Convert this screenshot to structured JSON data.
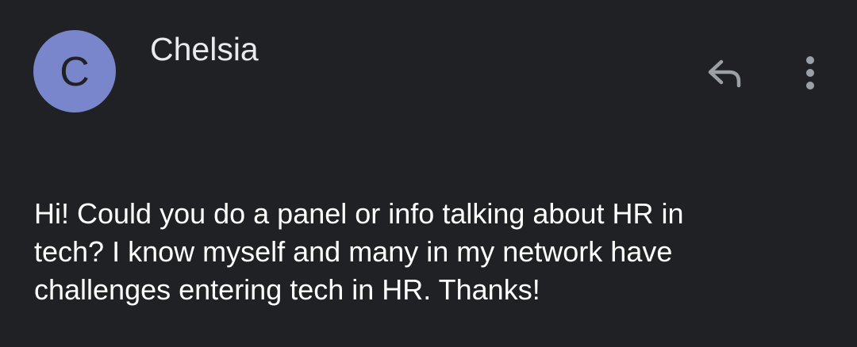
{
  "sender": {
    "avatar_letter": "C",
    "avatar_color": "#7986cb",
    "name": "Chelsia"
  },
  "actions": {
    "reply_icon": "reply-icon",
    "more_icon": "more-vertical-icon"
  },
  "message": {
    "lines": [
      "Hi! Could you do a panel or info talking about HR in",
      "tech? I know myself and many in my network have",
      "challenges entering tech in HR. Thanks!"
    ]
  },
  "colors": {
    "background": "#202124",
    "text_primary": "#e8eaed",
    "icon": "#9aa0a6"
  }
}
